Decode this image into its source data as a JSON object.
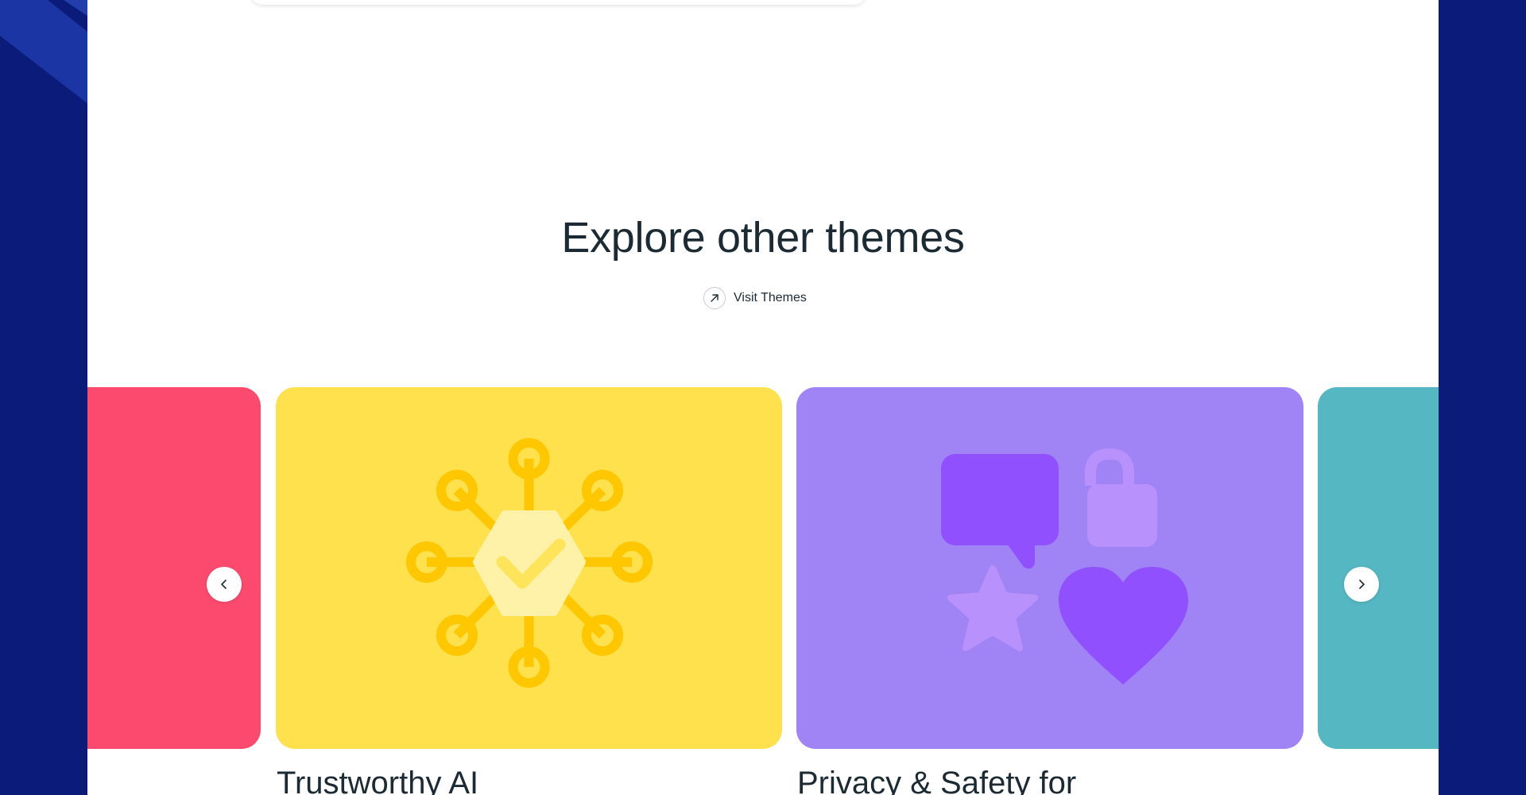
{
  "section": {
    "heading": "Explore other themes",
    "visit_link": {
      "label": "Visit Themes",
      "icon": "arrow-up-right-icon"
    }
  },
  "carousel": {
    "prev_icon": "chevron-left-icon",
    "next_icon": "chevron-right-icon",
    "cards": [
      {
        "title": "",
        "color": "#fb4a6e",
        "illustration": "partial-card"
      },
      {
        "title": "Trustworthy AI",
        "color": "#ffe14e",
        "illustration": "network-check-icon"
      },
      {
        "title": "Privacy & Safety for",
        "color": "#a084f5",
        "illustration": "chat-lock-star-heart-icons"
      },
      {
        "title": "",
        "color": "#54b7c2",
        "illustration": "partial-card"
      }
    ]
  },
  "colors": {
    "outer_background": "#0a1b7a",
    "page_background": "#ffffff",
    "text": "#1c2b33"
  }
}
